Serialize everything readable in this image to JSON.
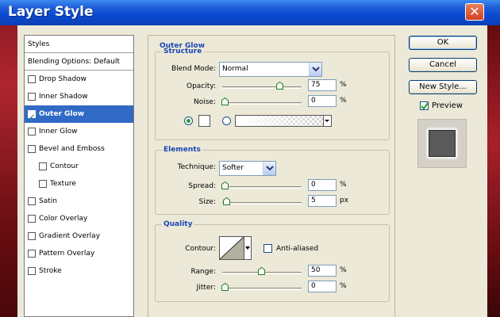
{
  "window": {
    "title": "Layer Style",
    "close_glyph": "✕"
  },
  "styles_list": [
    {
      "label": "Styles",
      "checkbox": false,
      "checked": false,
      "indent": false,
      "selected": false
    },
    {
      "label": "Blending Options: Default",
      "checkbox": false,
      "checked": false,
      "indent": false,
      "selected": false
    },
    {
      "label": "Drop Shadow",
      "checkbox": true,
      "checked": false,
      "indent": false,
      "selected": false
    },
    {
      "label": "Inner Shadow",
      "checkbox": true,
      "checked": false,
      "indent": false,
      "selected": false
    },
    {
      "label": "Outer Glow",
      "checkbox": true,
      "checked": true,
      "indent": false,
      "selected": true
    },
    {
      "label": "Inner Glow",
      "checkbox": true,
      "checked": false,
      "indent": false,
      "selected": false
    },
    {
      "label": "Bevel and Emboss",
      "checkbox": true,
      "checked": false,
      "indent": false,
      "selected": false
    },
    {
      "label": "Contour",
      "checkbox": true,
      "checked": false,
      "indent": true,
      "selected": false
    },
    {
      "label": "Texture",
      "checkbox": true,
      "checked": false,
      "indent": true,
      "selected": false
    },
    {
      "label": "Satin",
      "checkbox": true,
      "checked": false,
      "indent": false,
      "selected": false
    },
    {
      "label": "Color Overlay",
      "checkbox": true,
      "checked": false,
      "indent": false,
      "selected": false
    },
    {
      "label": "Gradient Overlay",
      "checkbox": true,
      "checked": false,
      "indent": false,
      "selected": false
    },
    {
      "label": "Pattern Overlay",
      "checkbox": true,
      "checked": false,
      "indent": false,
      "selected": false
    },
    {
      "label": "Stroke",
      "checkbox": true,
      "checked": false,
      "indent": false,
      "selected": false
    }
  ],
  "outer_glow": {
    "title": "Outer Glow",
    "structure": {
      "title": "Structure",
      "blend_mode_label": "Blend Mode:",
      "blend_mode_value": "Normal",
      "opacity_label": "Opacity:",
      "opacity_value": "75",
      "opacity_unit": "%",
      "noise_label": "Noise:",
      "noise_value": "0",
      "noise_unit": "%",
      "fill_mode": "color"
    },
    "elements": {
      "title": "Elements",
      "technique_label": "Technique:",
      "technique_value": "Softer",
      "spread_label": "Spread:",
      "spread_value": "0",
      "spread_unit": "%",
      "size_label": "Size:",
      "size_value": "5",
      "size_unit": "px"
    },
    "quality": {
      "title": "Quality",
      "contour_label": "Contour:",
      "anti_aliased_label": "Anti-aliased",
      "anti_aliased_checked": false,
      "range_label": "Range:",
      "range_value": "50",
      "range_unit": "%",
      "jitter_label": "Jitter:",
      "jitter_value": "0",
      "jitter_unit": "%"
    }
  },
  "buttons": {
    "ok": "OK",
    "cancel": "Cancel",
    "new_style": "New Style...",
    "preview_label": "Preview",
    "preview_checked": true
  },
  "slider_levels": {
    "opacity": 0.75,
    "noise": 0,
    "spread": 0,
    "size": 0.02,
    "range": 0.5,
    "jitter": 0
  },
  "colors": {
    "title_bar": "#0a4ad0",
    "selected_item": "#316ac5",
    "section_title": "#1c46b4",
    "dialog_bg": "#ece9d8",
    "preview_fill": "#5a5a5a"
  }
}
